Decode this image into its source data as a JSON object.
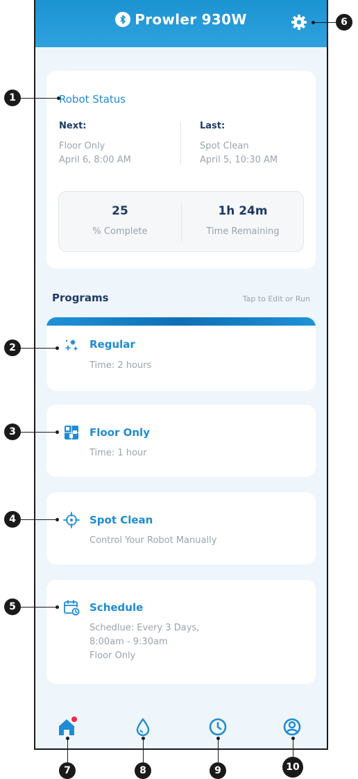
{
  "header": {
    "title": "Prowler 930W"
  },
  "status": {
    "title": "Robot Status",
    "next": {
      "label": "Next:",
      "program": "Floor Only",
      "time": "April 6, 8:00 AM"
    },
    "last": {
      "label": "Last:",
      "program": "Spot Clean",
      "time": "April 5, 10:30 AM"
    },
    "percent": {
      "value": "25",
      "caption": "% Complete"
    },
    "remaining": {
      "value": "1h 24m",
      "caption": "Time Remaining"
    }
  },
  "programs": {
    "heading": "Programs",
    "hint": "Tap to Edit or Run",
    "items": [
      {
        "name": "Regular",
        "desc": [
          "Time: 2 hours"
        ]
      },
      {
        "name": "Floor Only",
        "desc": [
          "Time: 1 hour"
        ]
      },
      {
        "name": "Spot Clean",
        "desc": [
          "Control Your Robot Manually"
        ]
      },
      {
        "name": "Schedule",
        "desc": [
          "Schedlue: Every 3 Days,",
          "8:00am - 9:30am",
          "Floor Only"
        ]
      }
    ]
  },
  "callouts": [
    "1",
    "2",
    "3",
    "4",
    "5",
    "6",
    "7",
    "8",
    "9",
    "10"
  ],
  "colors": {
    "primary": "#1f8bd3",
    "navy": "#1e3a66",
    "muted": "#9aa3ad",
    "alert": "#ef2a4a"
  }
}
